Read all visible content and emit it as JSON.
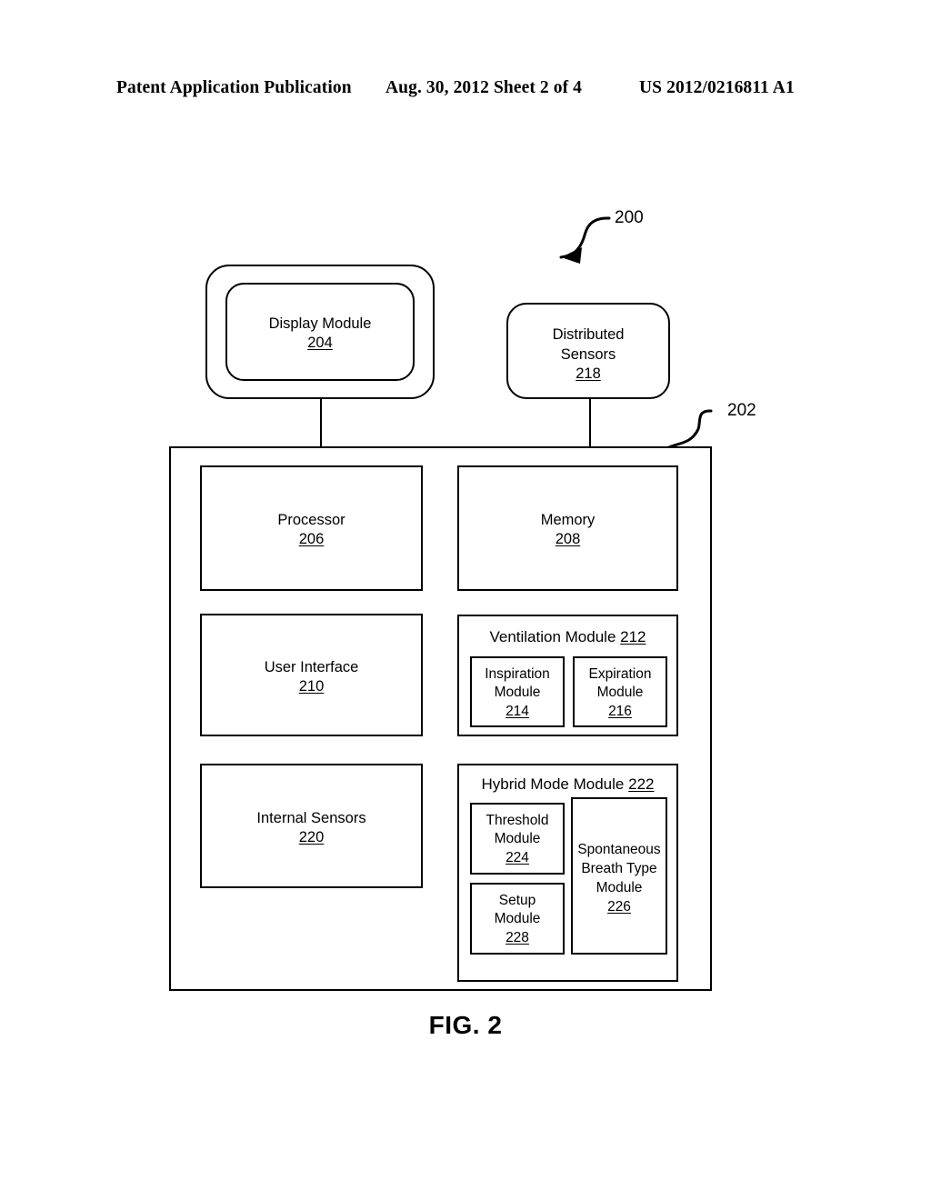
{
  "header": {
    "left": "Patent Application Publication",
    "middle": "Aug. 30, 2012  Sheet 2 of 4",
    "right": "US 2012/0216811 A1"
  },
  "figure": {
    "caption": "FIG. 2",
    "system_ref": "200",
    "controller_ref": "202"
  },
  "blocks": {
    "display_module": {
      "label": "Display Module",
      "ref": "204"
    },
    "distributed_sensors": {
      "label": "Distributed\nSensors",
      "ref": "218"
    },
    "processor": {
      "label": "Processor",
      "ref": "206"
    },
    "memory": {
      "label": "Memory",
      "ref": "208"
    },
    "user_interface": {
      "label": "User Interface",
      "ref": "210"
    },
    "internal_sensors": {
      "label": "Internal Sensors",
      "ref": "220"
    },
    "ventilation_module": {
      "label": "Ventilation Module",
      "ref": "212",
      "children": {
        "inspiration_module": {
          "label": "Inspiration\nModule",
          "ref": "214"
        },
        "expiration_module": {
          "label": "Expiration\nModule",
          "ref": "216"
        }
      }
    },
    "hybrid_mode_module": {
      "label": "Hybrid Mode Module",
      "ref": "222",
      "children": {
        "threshold_module": {
          "label": "Threshold\nModule",
          "ref": "224"
        },
        "setup_module": {
          "label": "Setup\nModule",
          "ref": "228"
        },
        "spontaneous_breath_type_module": {
          "label": "Spontaneous\nBreath Type\nModule",
          "ref": "226"
        }
      }
    }
  },
  "colors": {
    "ink": "#000000",
    "paper": "#ffffff"
  }
}
